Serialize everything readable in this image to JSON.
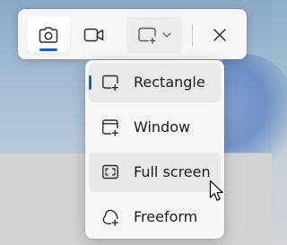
{
  "toolbar": {
    "buttons": [
      {
        "id": "snip-photo",
        "icon": "camera-icon",
        "active": true
      },
      {
        "id": "snip-video",
        "icon": "video-camera-icon",
        "active": false
      },
      {
        "id": "snip-mode",
        "icon": "rectangle-snip-icon",
        "dropdown_icon": "chevron-down-icon"
      },
      {
        "id": "close",
        "icon": "close-icon"
      }
    ],
    "accent_color": "#1f5fbf"
  },
  "menu": {
    "items": [
      {
        "label": "Rectangle",
        "icon": "rectangle-snip-icon",
        "selected": true
      },
      {
        "label": "Window",
        "icon": "window-snip-icon",
        "selected": false
      },
      {
        "label": "Full screen",
        "icon": "fullscreen-snip-icon",
        "selected": false,
        "hovered": true
      },
      {
        "label": "Freeform",
        "icon": "freeform-snip-icon",
        "selected": false
      }
    ]
  }
}
